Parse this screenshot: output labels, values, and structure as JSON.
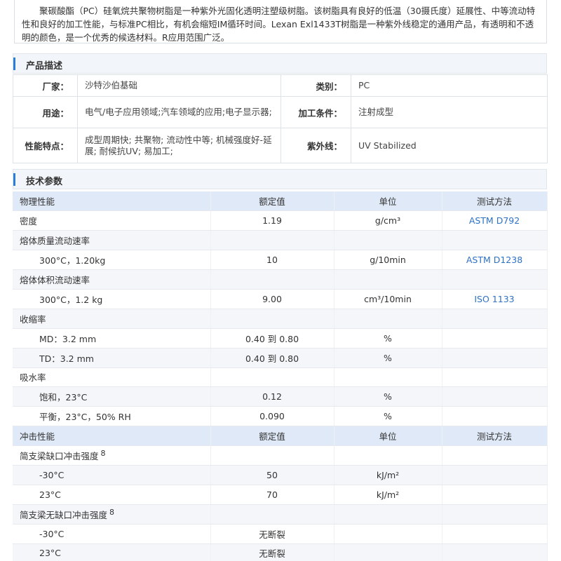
{
  "intro": {
    "text": "聚碳酸酯（PC）硅氧烷共聚物树脂是一种紫外光固化透明注塑级树脂。该树脂具有良好的低温（30摄氏度）延展性、中等流动特性和良好的加工性能，与标准PC相比，有机会缩短IM循环时间。Lexan Exl1433T树脂是一种紫外线稳定的通用产品，有透明和不透明的颜色，是一个优秀的候选材料。R应用范围广泛。"
  },
  "product_desc": {
    "title": "产品描述",
    "rows": [
      {
        "k1": "厂家：",
        "v1": "沙特沙伯基础",
        "k2": "类别：",
        "v2": "PC"
      },
      {
        "k1": "用途：",
        "v1": "电气/电子应用领域;汽车领域的应用;电子显示器;",
        "k2": "加工条件：",
        "v2": "注射成型"
      },
      {
        "k1": "性能特点：",
        "v1": "成型周期快; 共聚物; 流动性中等; 机械强度好-延展; 耐候抗UV; 易加工;",
        "k2": "紫外线：",
        "v2": "UV Stabilized"
      }
    ]
  },
  "tech": {
    "title": "技术参数",
    "rows": [
      {
        "kind": "hdr",
        "name": "物理性能",
        "value": "额定值",
        "unit": "单位",
        "method": "测试方法"
      },
      {
        "kind": "item",
        "name": "密度",
        "value": "1.19",
        "unit": "g/cm³",
        "method": "ASTM D792"
      },
      {
        "kind": "group",
        "name": "熔体质量流动速率",
        "value": "",
        "unit": "",
        "method": ""
      },
      {
        "kind": "sub",
        "name": "300°C，1.20kg",
        "value": "10",
        "unit": "g/10min",
        "method": "ASTM D1238"
      },
      {
        "kind": "group",
        "name": "熔体体积流动速率",
        "value": "",
        "unit": "",
        "method": ""
      },
      {
        "kind": "sub",
        "name": "300°C，1.2 kg",
        "value": "9.00",
        "unit": "cm³/10min",
        "method": "ISO 1133"
      },
      {
        "kind": "group",
        "name": "收缩率",
        "value": "",
        "unit": "",
        "method": ""
      },
      {
        "kind": "sub",
        "name": "MD：3.2 mm",
        "value": "0.40 到 0.80",
        "unit": "%",
        "method": ""
      },
      {
        "kind": "sub",
        "name": "TD：3.2 mm",
        "value": "0.40 到 0.80",
        "unit": "%",
        "method": ""
      },
      {
        "kind": "group",
        "name": "吸水率",
        "value": "",
        "unit": "",
        "method": ""
      },
      {
        "kind": "sub",
        "name": "饱和，23°C",
        "value": "0.12",
        "unit": "%",
        "method": ""
      },
      {
        "kind": "sub",
        "name": "平衡，23°C，50% RH",
        "value": "0.090",
        "unit": "%",
        "method": ""
      },
      {
        "kind": "hdr",
        "name": "冲击性能",
        "value": "额定值",
        "unit": "单位",
        "method": "测试方法"
      },
      {
        "kind": "group",
        "name": "简支梁缺口冲击强度",
        "note": "8",
        "value": "",
        "unit": "",
        "method": ""
      },
      {
        "kind": "sub",
        "name": "-30°C",
        "value": "50",
        "unit": "kJ/m²",
        "method": ""
      },
      {
        "kind": "sub",
        "name": "23°C",
        "value": "70",
        "unit": "kJ/m²",
        "method": ""
      },
      {
        "kind": "group",
        "name": "简支梁无缺口冲击强度",
        "note": "8",
        "value": "",
        "unit": "",
        "method": ""
      },
      {
        "kind": "sub",
        "name": "-30°C",
        "value": "无断裂",
        "unit": "",
        "method": ""
      },
      {
        "kind": "sub",
        "name": "23°C",
        "value": "无断裂",
        "unit": "",
        "method": ""
      }
    ]
  },
  "colors": {
    "accent": "#2a7fd4",
    "link": "#2e72c4",
    "header_bg": "#dfe9f7"
  }
}
